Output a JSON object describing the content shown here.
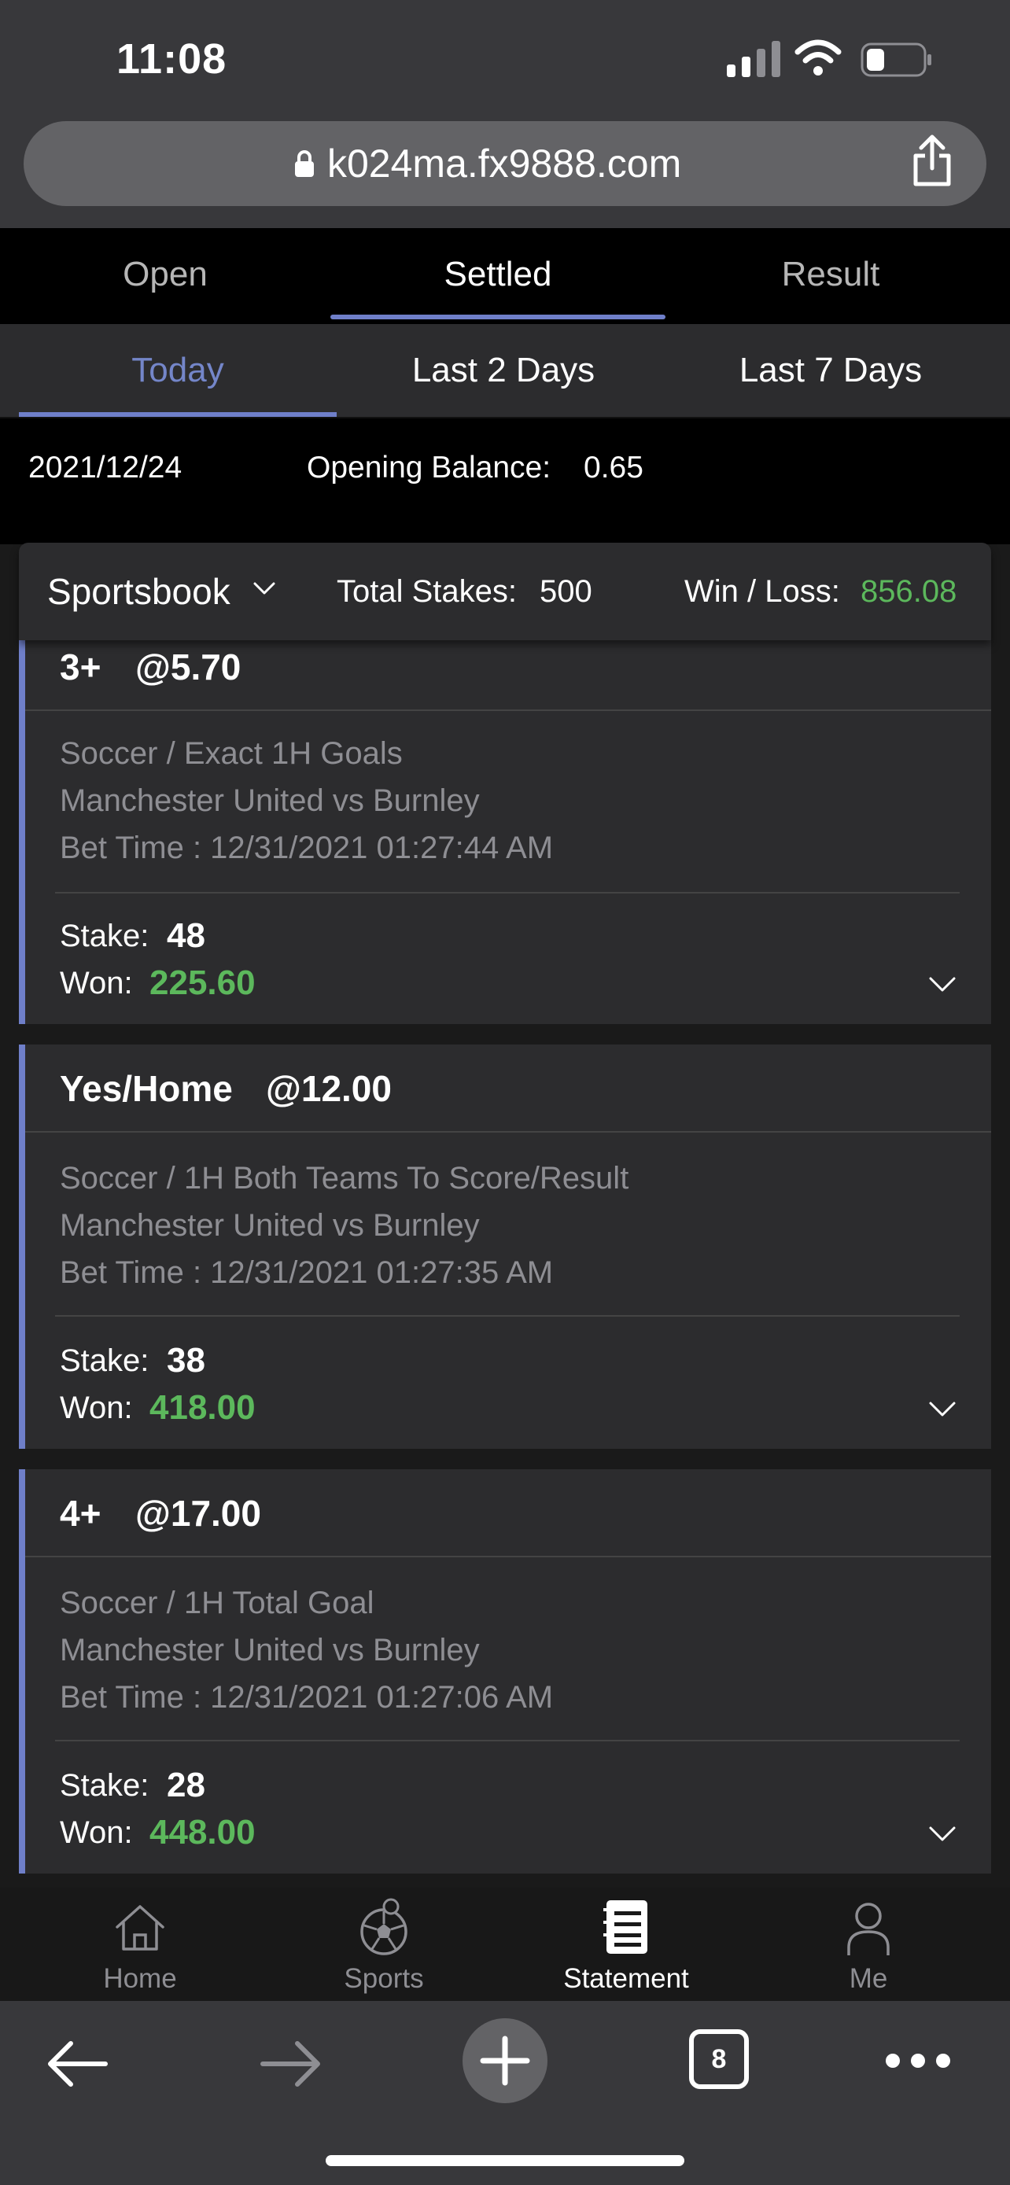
{
  "status_bar": {
    "time": "11:08"
  },
  "browser": {
    "url": "k024ma.fx9888.com",
    "tab_count": "8"
  },
  "tabs": [
    {
      "label": "Open"
    },
    {
      "label": "Settled"
    },
    {
      "label": "Result"
    }
  ],
  "active_tab": "Settled",
  "period_tabs": [
    {
      "label": "Today"
    },
    {
      "label": "Last 2 Days"
    },
    {
      "label": "Last 7 Days"
    }
  ],
  "active_period": "Today",
  "balance": {
    "date": "2021/12/24",
    "opening_balance_label": "Opening Balance:",
    "opening_balance_value": "0.65"
  },
  "summary": {
    "product": "Sportsbook",
    "total_stakes_label": "Total Stakes:",
    "total_stakes_value": "500",
    "win_loss_label": "Win / Loss:",
    "win_loss_value": "856.08"
  },
  "bets": [
    {
      "selection": "3+",
      "odds": "@5.70",
      "market": "Soccer / Exact 1H Goals",
      "match": "Manchester United vs Burnley",
      "bet_time": "Bet Time : 12/31/2021 01:27:44 AM",
      "stake_label": "Stake:",
      "stake": "48",
      "won_label": "Won:",
      "won": "225.60"
    },
    {
      "selection": "Yes/Home",
      "odds": "@12.00",
      "market": "Soccer / 1H Both Teams To Score/Result",
      "match": "Manchester United vs Burnley",
      "bet_time": "Bet Time : 12/31/2021 01:27:35 AM",
      "stake_label": "Stake:",
      "stake": "38",
      "won_label": "Won:",
      "won": "418.00"
    },
    {
      "selection": "4+",
      "odds": "@17.00",
      "market": "Soccer / 1H Total Goal",
      "match": "Manchester United vs Burnley",
      "bet_time": "Bet Time : 12/31/2021 01:27:06 AM",
      "stake_label": "Stake:",
      "stake": "28",
      "won_label": "Won:",
      "won": "448.00"
    }
  ],
  "bottom_nav": [
    {
      "label": "Home",
      "icon": "home-icon"
    },
    {
      "label": "Sports",
      "icon": "soccer-ball-icon"
    },
    {
      "label": "Statement",
      "icon": "statement-icon"
    },
    {
      "label": "Me",
      "icon": "user-icon"
    }
  ],
  "active_nav": "Statement",
  "colors": {
    "accent": "#6f7fc9",
    "win": "#5cb85c",
    "card_bg": "#2c2c2e"
  }
}
